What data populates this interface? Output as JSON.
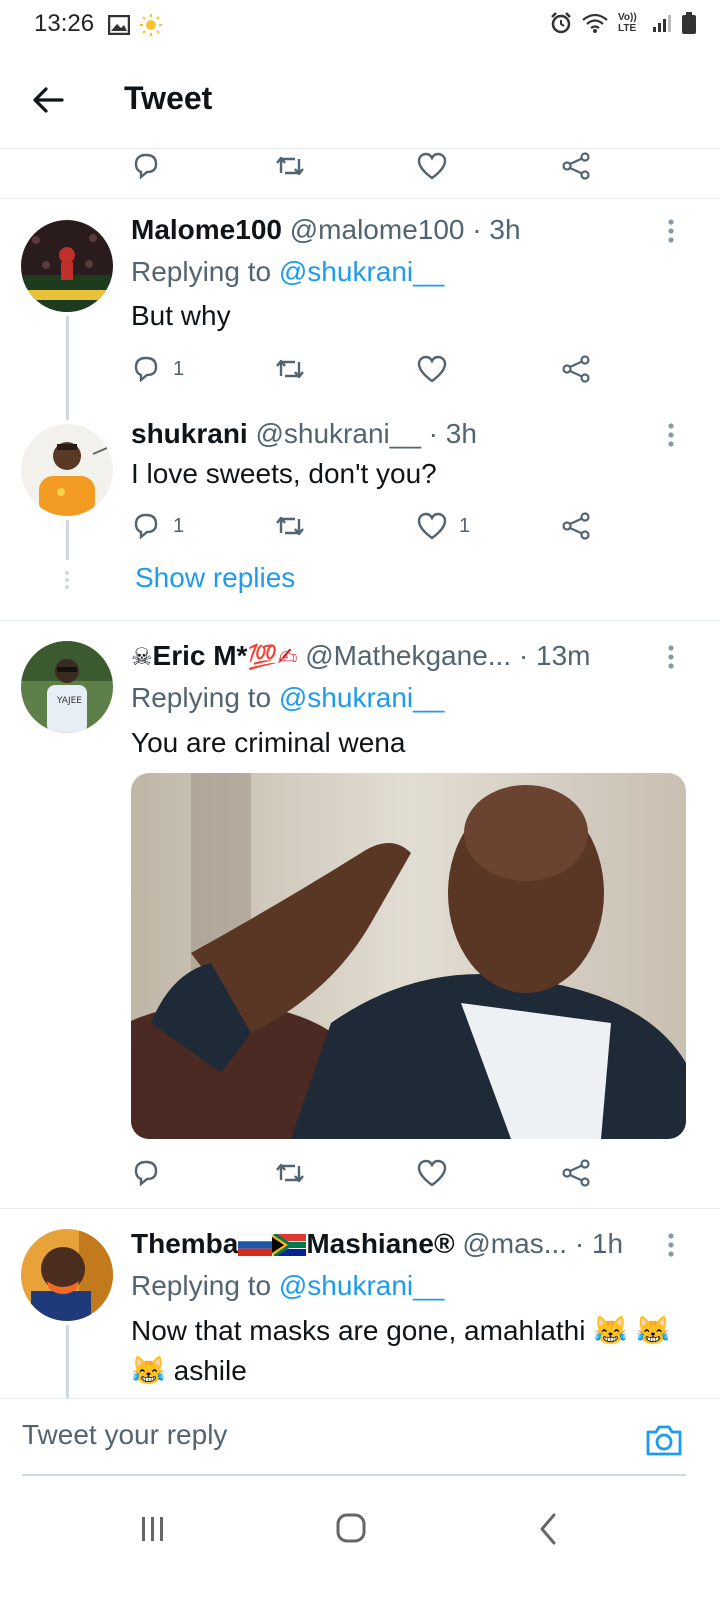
{
  "status_bar": {
    "time": "13:26",
    "network": "Vo)) LTE"
  },
  "header": {
    "title": "Tweet"
  },
  "tweets": [
    {
      "name": "Malome100",
      "handle": "@malome100",
      "time": "· 3h",
      "replying_label": "Replying to ",
      "replying_to": "@shukrani__",
      "text": "But why",
      "reply_count": "1",
      "like_count": ""
    },
    {
      "name": "shukrani",
      "handle": "@shukrani__",
      "time": "· 3h",
      "text": "I love sweets, don't you?",
      "reply_count": "1",
      "like_count": "1",
      "show_replies": "Show replies"
    },
    {
      "name_prefix_emoji": "☠",
      "name": "Eric M*",
      "name_suffix_emoji": "💯✍",
      "handle": "@Mathekgane...",
      "time": "· 13m",
      "replying_label": "Replying to ",
      "replying_to": "@shukrani__",
      "text": "You are criminal wena"
    },
    {
      "name_part1": "Themba",
      "name_part2": "Mashiane®",
      "handle": "@mas...",
      "time": "· 1h",
      "replying_label": "Replying to ",
      "replying_to": "@shukrani__",
      "text": "Now that masks are gone, amahlathi 😹 😹😹 ashile"
    }
  ],
  "reply_box": {
    "placeholder": "Tweet your reply"
  },
  "colors": {
    "accent": "#1d9bf0",
    "secondary_text": "#536471",
    "divider": "#e6ecf0"
  }
}
